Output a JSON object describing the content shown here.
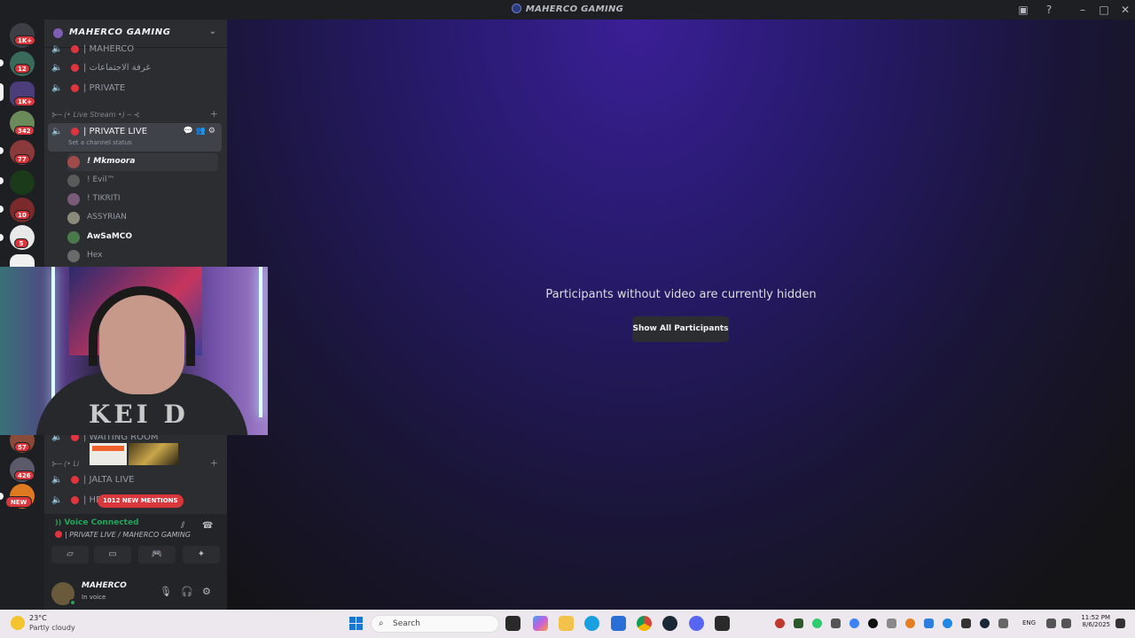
{
  "window": {
    "title": "MAHERCO GAMING",
    "icons": [
      "inbox-icon",
      "help-icon",
      "minimize-icon",
      "maximize-icon",
      "close-icon"
    ]
  },
  "servers": [
    {
      "badge": "1K+",
      "color": "#5865f2"
    },
    {
      "badge": "12",
      "color": "#3a6a5a"
    },
    {
      "badge": "1K+",
      "color": "#4a3d7a"
    },
    {
      "badge": "342",
      "color": "#6b8a5a"
    },
    {
      "badge": "77",
      "color": "#8a3a3a"
    },
    {
      "badge": "",
      "color": "#1a3a1a"
    },
    {
      "badge": "10",
      "color": "#7a2a2a"
    },
    {
      "badge": "5",
      "color": "#e8e8e8"
    },
    {
      "badge": "",
      "color": "#f0f0f0"
    },
    {
      "badge": "57",
      "color": "#8a4a3a"
    },
    {
      "badge": "426",
      "color": "#5a5a6a"
    },
    {
      "badge": "NEW",
      "color": "#e07a20"
    }
  ],
  "sidebar": {
    "server_name": "MAHERCO GAMING",
    "channels_top": [
      {
        "label": "| MAHERCO"
      },
      {
        "label": "| غرفة الاجتماعات"
      },
      {
        "label": "| PRIVATE"
      }
    ],
    "category_live": "⊱─ (• Live Stream •) ─ ⊰",
    "active_channel": {
      "label": "| PRIVATE LIVE",
      "status": "Set a channel status"
    },
    "users": [
      {
        "name": "! Mkmoora"
      },
      {
        "name": "! Evil™"
      },
      {
        "name": "! TIKRITI"
      },
      {
        "name": "ASSYRIAN"
      },
      {
        "name": "AwSaMCO"
      },
      {
        "name": "Hex"
      }
    ],
    "waiting_room": "| WAITING ROOM",
    "category_live2": "⊱─ (• Li",
    "channels_bottom": [
      {
        "label": "| JALTA LIVE"
      },
      {
        "label": "| HE"
      }
    ],
    "mentions_pill": "1012 NEW MENTIONS"
  },
  "voice": {
    "status": "Voice Connected",
    "channel": "| PRIVATE LIVE / MAHERCO GAMING"
  },
  "user": {
    "name": "MAHERCO",
    "status": "In voice"
  },
  "stage": {
    "message": "Participants without video are currently hidden",
    "button": "Show All Participants"
  },
  "webcam": {
    "shirt_text": "KEI D"
  },
  "taskbar": {
    "temp": "23°C",
    "condition": "Partly cloudy",
    "search_placeholder": "Search",
    "lang": "ENG",
    "time": "11:52 PM",
    "date": "8/6/2025"
  }
}
